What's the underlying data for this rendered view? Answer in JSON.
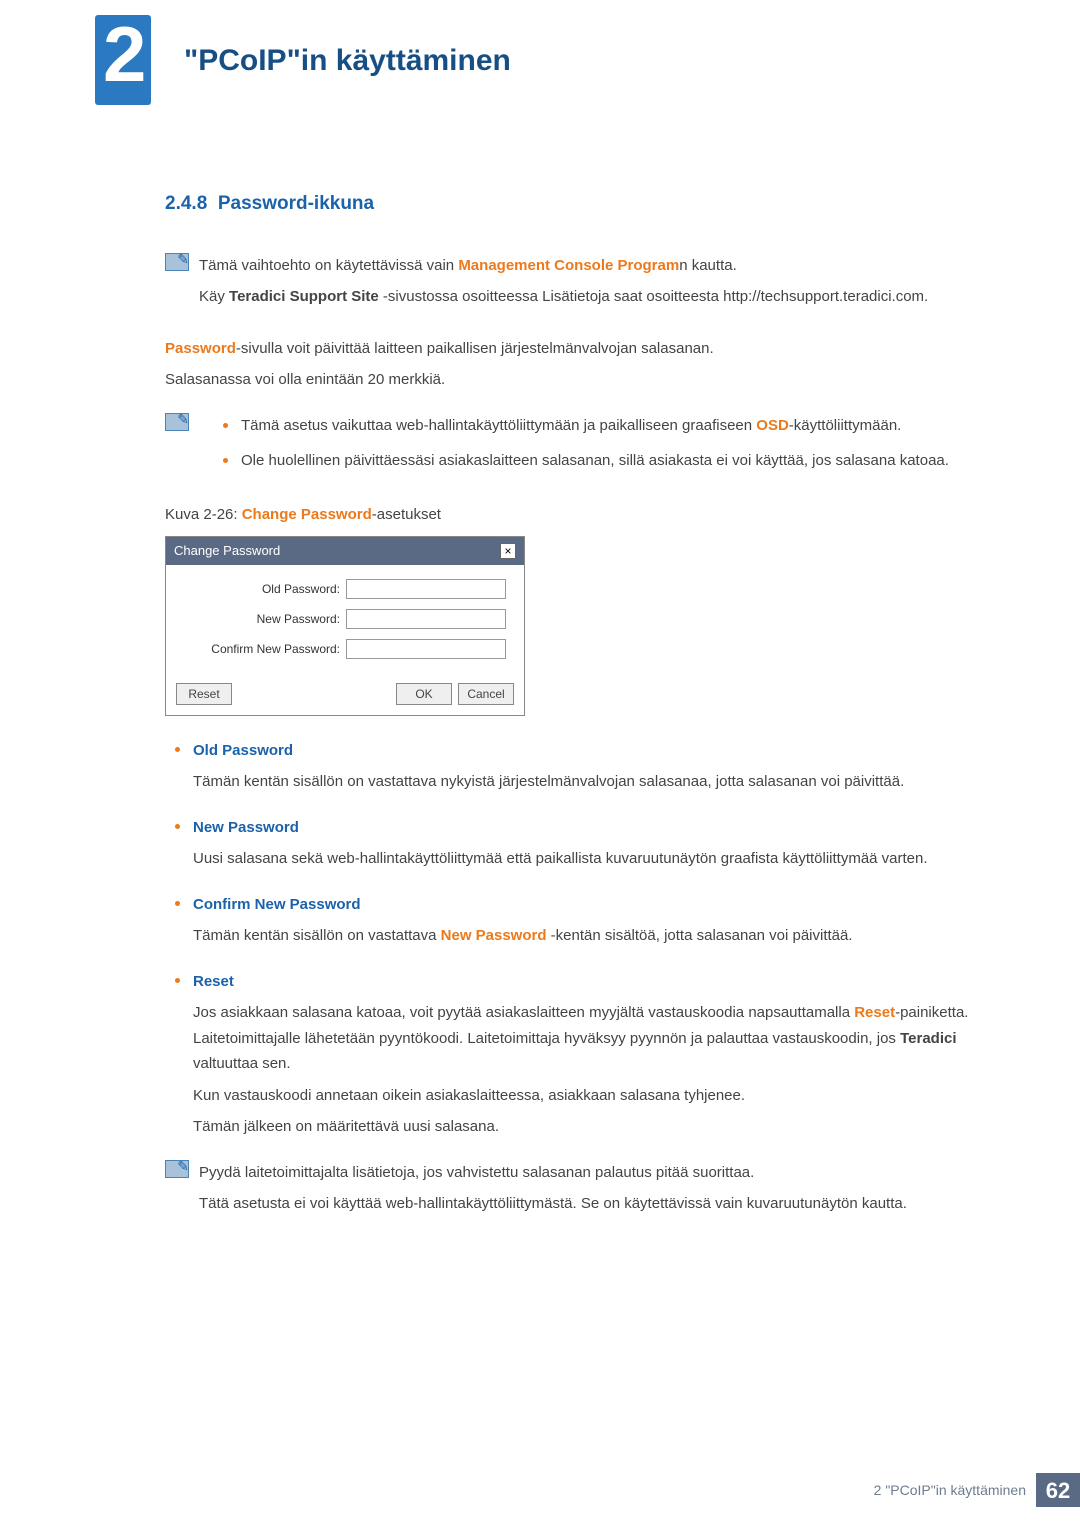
{
  "chapter": {
    "number": "2",
    "title": "\"PCoIP\"in käyttäminen"
  },
  "section": {
    "number": "2.4.8",
    "title": "Password-ikkuna"
  },
  "note1": {
    "line1a": "Tämä vaihtoehto on käytettävissä vain ",
    "line1b": "Management Console Program",
    "line1c": "n kautta.",
    "line2a": "Käy ",
    "line2b": "Teradici Support Site",
    "line2c": " -sivustossa osoitteessa Lisätietoja saat osoitteesta http://techsupport.teradici.com."
  },
  "intro": {
    "p1a": "Password",
    "p1b": "-sivulla voit päivittää laitteen paikallisen järjestelmänvalvojan salasanan.",
    "p2": "Salasanassa voi olla enintään 20 merkkiä."
  },
  "note2": {
    "b1a": "Tämä asetus vaikuttaa web-hallintakäyttöliittymään ja paikalliseen graafiseen ",
    "b1b": "OSD",
    "b1c": "-käyttöliittymään.",
    "b2": "Ole huolellinen päivittäessäsi asiakaslaitteen salasanan, sillä asiakasta ei voi käyttää, jos salasana katoaa."
  },
  "figure": {
    "prefix": "Kuva 2-26: ",
    "hl": "Change Password",
    "suffix": "-asetukset"
  },
  "dialog": {
    "title": "Change Password",
    "close": "×",
    "labels": {
      "old": "Old Password:",
      "new": "New Password:",
      "confirm": "Confirm New Password:"
    },
    "buttons": {
      "reset": "Reset",
      "ok": "OK",
      "cancel": "Cancel"
    }
  },
  "defs": {
    "old": {
      "term": "Old Password",
      "body": "Tämän kentän sisällön on vastattava nykyistä järjestelmänvalvojan salasanaa, jotta salasanan voi päivittää."
    },
    "new": {
      "term": "New Password",
      "body": "Uusi salasana sekä web-hallintakäyttöliittymää että paikallista kuvaruutunäytön graafista käyttöliittymää varten."
    },
    "confirm": {
      "term": "Confirm New Password",
      "pre": "Tämän kentän sisällön on vastattava ",
      "hl": "New Password",
      "post": " -kentän sisältöä, jotta salasanan voi päivittää."
    },
    "reset": {
      "term": "Reset",
      "p1a": "Jos asiakkaan salasana katoaa, voit pyytää asiakaslaitteen myyjältä vastauskoodia napsauttamalla ",
      "p1b": "Reset",
      "p1c": "-painiketta. Laitetoimittajalle lähetetään pyyntökoodi. Laitetoimittaja hyväksyy pyynnön ja palauttaa vastauskoodin, jos ",
      "p1d": "Teradici",
      "p1e": " valtuuttaa sen.",
      "p2": "Kun vastauskoodi annetaan oikein asiakaslaitteessa, asiakkaan salasana tyhjenee.",
      "p3": "Tämän jälkeen on määritettävä uusi salasana."
    }
  },
  "note3": {
    "l1": "Pyydä laitetoimittajalta lisätietoja, jos vahvistettu salasanan palautus pitää suorittaa.",
    "l2": "Tätä asetusta ei voi käyttää web-hallintakäyttöliittymästä. Se on käytettävissä vain kuvaruutunäytön kautta."
  },
  "footer": {
    "text": "2 \"PCoIP\"in käyttäminen",
    "page": "62"
  }
}
